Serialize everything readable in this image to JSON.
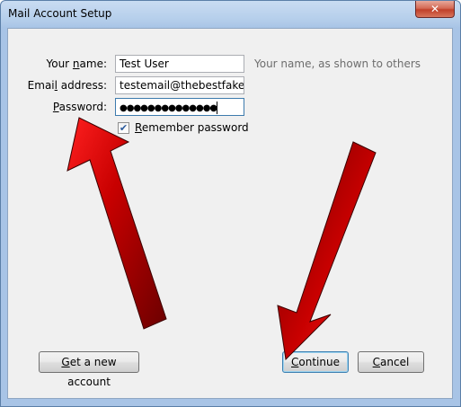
{
  "window": {
    "title": "Mail Account Setup",
    "close_glyph": "✕"
  },
  "form": {
    "name": {
      "label_prefix": "Your ",
      "label_accel": "n",
      "label_suffix": "ame:",
      "value": "Test User",
      "hint": "Your name, as shown to others"
    },
    "email": {
      "label_prefix": "Emai",
      "label_accel": "l",
      "label_suffix": " address:",
      "value": "testemail@thebestfakedor"
    },
    "password": {
      "label_prefix": "",
      "label_accel": "P",
      "label_suffix": "assword:",
      "value": "●●●●●●●●●●●●●●"
    },
    "remember": {
      "label_accel": "R",
      "label_rest": "emember password",
      "checked": true,
      "check_glyph": "✔"
    }
  },
  "buttons": {
    "get_account_accel": "G",
    "get_account_rest": "et a new account",
    "continue_accel": "C",
    "continue_rest": "ontinue",
    "cancel_accel": "C",
    "cancel_rest": "ancel"
  },
  "colors": {
    "arrow_dark": "#6b0000",
    "arrow_bright": "#ff1a1a"
  }
}
